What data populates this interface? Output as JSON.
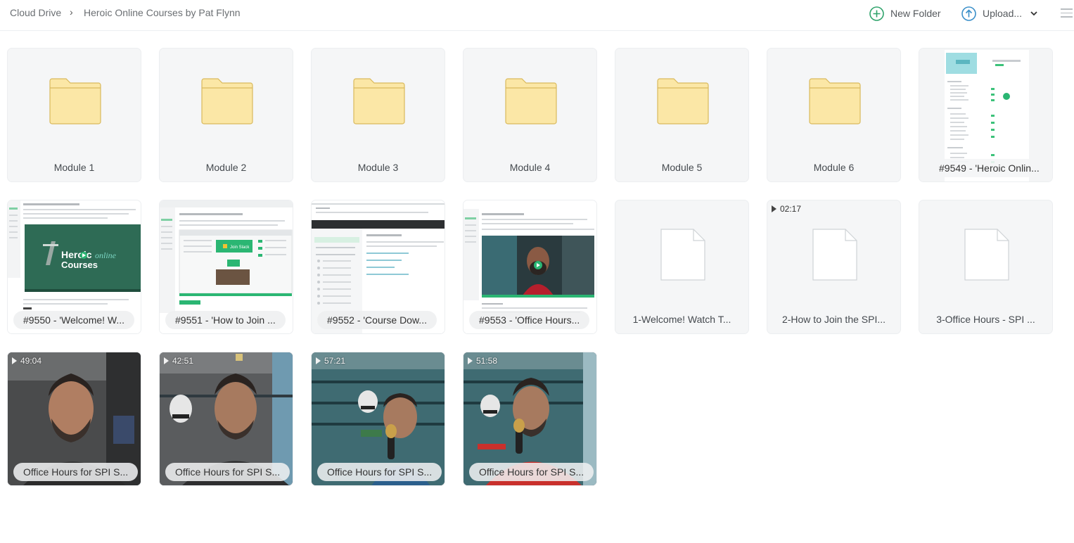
{
  "breadcrumb": {
    "root": "Cloud Drive",
    "separator": "›",
    "current": "Heroic Online Courses by Pat Flynn"
  },
  "toolbar": {
    "new_folder": "New Folder",
    "upload": "Upload...",
    "accent_color": "#2fa36b",
    "upload_color": "#3a8fc9"
  },
  "folders": [
    {
      "label": "Module 1"
    },
    {
      "label": "Module 2"
    },
    {
      "label": "Module 3"
    },
    {
      "label": "Module 4"
    },
    {
      "label": "Module 5"
    },
    {
      "label": "Module 6"
    }
  ],
  "image_files": [
    {
      "label": "#9549 - 'Heroic Onlin..."
    },
    {
      "label": "#9550 - 'Welcome! W..."
    },
    {
      "label": "#9551 - 'How to Join ..."
    },
    {
      "label": "#9552 - 'Course Dow..."
    },
    {
      "label": "#9553 - 'Office Hours..."
    }
  ],
  "thumb_text": {
    "heroic_title_1": "Heroic",
    "heroic_title_2": "online",
    "heroic_title_3": "Courses",
    "join_button": "Join Slack"
  },
  "doc_files": [
    {
      "label": "1-Welcome! Watch T...",
      "duration": ""
    },
    {
      "label": "2-How to Join the SPI...",
      "duration": "02:17"
    },
    {
      "label": "3-Office Hours - SPI ...",
      "duration": ""
    }
  ],
  "videos": [
    {
      "label": "Office Hours for SPI S...",
      "duration": "49:04"
    },
    {
      "label": "Office Hours for SPI S...",
      "duration": "42:51"
    },
    {
      "label": "Office Hours for SPI S...",
      "duration": "57:21"
    },
    {
      "label": "Office Hours for SPI S...",
      "duration": "51:58"
    }
  ]
}
